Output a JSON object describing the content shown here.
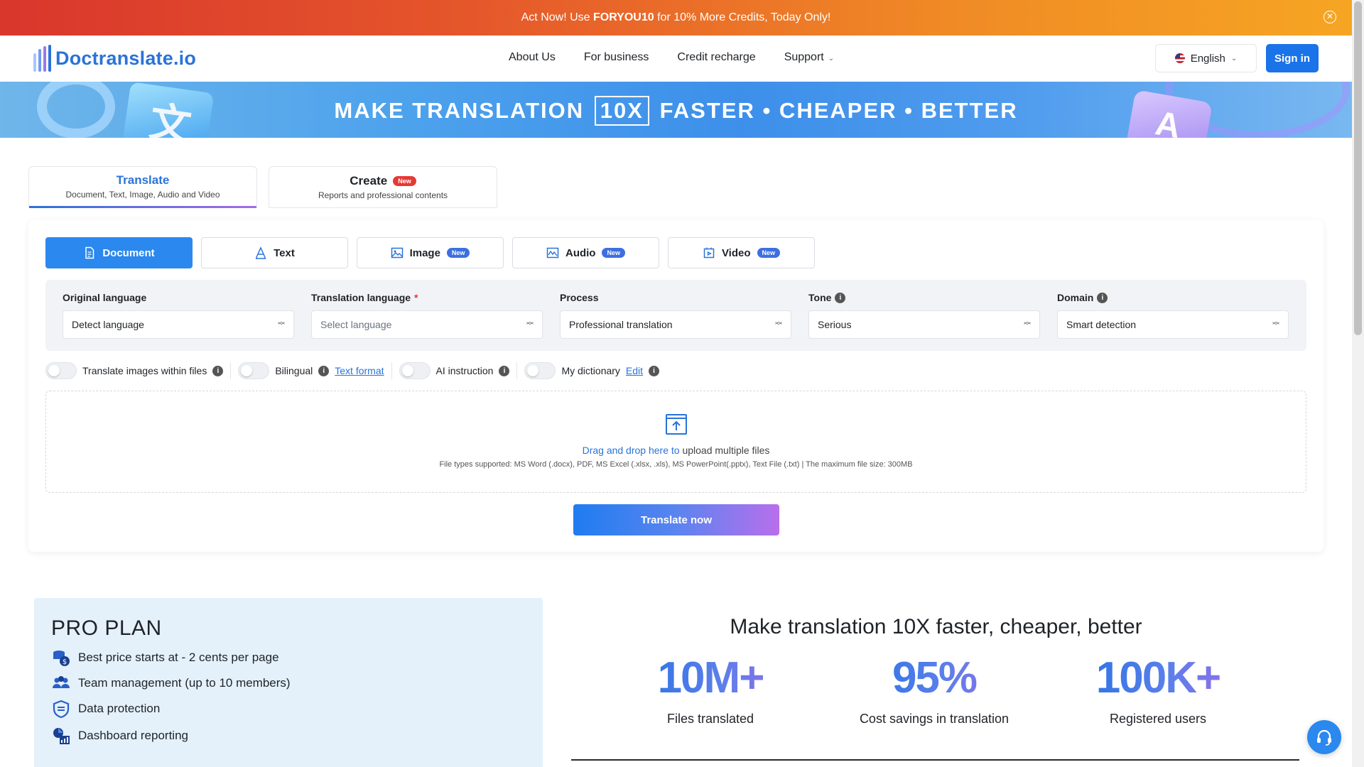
{
  "promo": {
    "prefix": "Act Now! Use ",
    "code": "FORYOU10",
    "suffix": " for 10% More Credits, Today Only!",
    "close_icon": "close-circle-icon"
  },
  "header": {
    "logo_text": "Doctranslate.io",
    "nav": [
      "About Us",
      "For business",
      "Credit recharge",
      "Support"
    ],
    "language": "English",
    "signin": "Sign in"
  },
  "banner": {
    "before": "MAKE TRANSLATION",
    "boxed": "10X",
    "after": "FASTER • CHEAPER • BETTER"
  },
  "mode_tabs": [
    {
      "title": "Translate",
      "subtitle": "Document, Text, Image, Audio and Video",
      "active": true
    },
    {
      "title": "Create",
      "badge": "New",
      "subtitle": "Reports and professional contents",
      "active": false
    }
  ],
  "type_tabs": [
    {
      "label": "Document",
      "icon": "document-icon",
      "active": true
    },
    {
      "label": "Text",
      "icon": "text-icon"
    },
    {
      "label": "Image",
      "icon": "image-icon",
      "badge": "New"
    },
    {
      "label": "Audio",
      "icon": "audio-icon",
      "badge": "New"
    },
    {
      "label": "Video",
      "icon": "video-icon",
      "badge": "New"
    }
  ],
  "settings": {
    "original_language": {
      "label": "Original language",
      "value": "Detect language"
    },
    "translation_language": {
      "label": "Translation language",
      "required_mark": "*",
      "placeholder": "Select language"
    },
    "process": {
      "label": "Process",
      "value": "Professional translation"
    },
    "tone": {
      "label": "Tone",
      "value": "Serious"
    },
    "domain": {
      "label": "Domain",
      "value": "Smart detection"
    }
  },
  "options": {
    "translate_images": "Translate images within files",
    "bilingual": "Bilingual",
    "text_format": "Text format",
    "ai_instruction": "AI instruction",
    "my_dictionary": "My dictionary",
    "edit": "Edit"
  },
  "upload": {
    "link": "Drag and drop here to",
    "text": " upload multiple files",
    "supported": "File types supported: MS Word (.docx), PDF, MS Excel (.xlsx, .xls), MS PowerPoint(.pptx), Text File (.txt) | The maximum file size: 300MB"
  },
  "translate_button": "Translate now",
  "pro_plan": {
    "title": "PRO PLAN",
    "items": [
      "Best price starts at - 2 cents per page",
      "Team management (up to 10 members)",
      "Data protection",
      "Dashboard reporting"
    ]
  },
  "stats": {
    "title": "Make translation 10X faster, cheaper, better",
    "items": [
      {
        "value": "10M+",
        "label": "Files translated"
      },
      {
        "value": "95%",
        "label": "Cost savings in translation"
      },
      {
        "value": "100K+",
        "label": "Registered users"
      }
    ]
  },
  "colors": {
    "accent": "#2a88ee",
    "brand": "#2a73d8",
    "badge_new": "#e53935"
  }
}
